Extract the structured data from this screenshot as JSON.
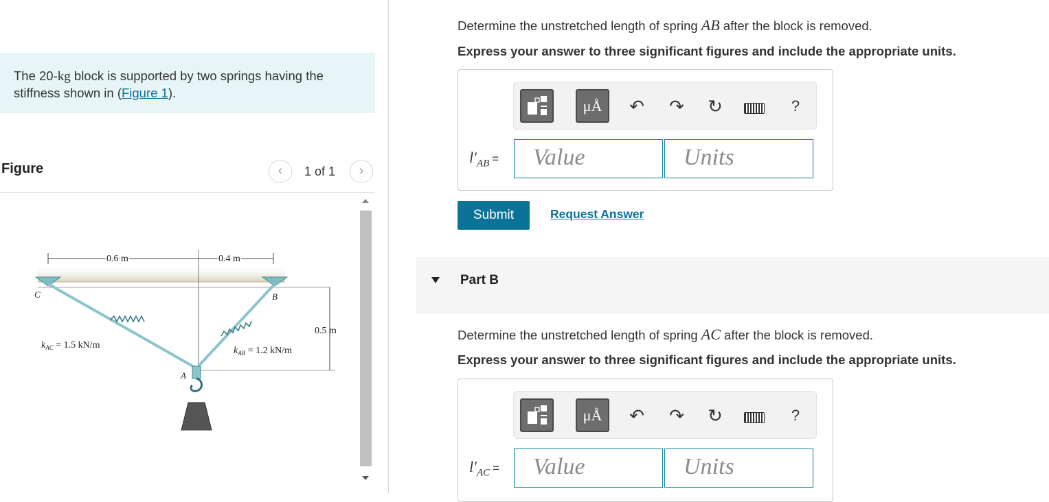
{
  "problem": {
    "intro_pre": "The 20-",
    "intro_kg": "kg",
    "intro_mid": " block is supported by two springs having the stiffness shown in (",
    "figure_link": "Figure 1",
    "intro_post": ")."
  },
  "figure": {
    "heading": "Figure",
    "pager": "1 of 1",
    "prev_icon": "chevron-left-icon",
    "next_icon": "chevron-right-icon",
    "labels": {
      "dim_left": "0.6 m",
      "dim_right": "0.4 m",
      "dim_vert": "0.5 m",
      "point_c": "C",
      "point_b": "B",
      "point_a": "A",
      "k_ac": "k",
      "k_ac_sub": "AC",
      "k_ac_val": " = 1.5 kN/m",
      "k_ab": "k",
      "k_ab_sub": "AB",
      "k_ab_val": " = 1.2 kN/m"
    }
  },
  "part_a": {
    "prompt_pre": "Determine the unstretched length of spring ",
    "prompt_var": "AB",
    "prompt_post": " after the block is removed.",
    "express": "Express your answer to three significant figures and include the appropriate units.",
    "var_main": "l′",
    "var_sub": "AB",
    "var_eq": "=",
    "value_placeholder": "Value",
    "units_placeholder": "Units",
    "toolbar": {
      "templates_icon": "fraction-template-icon",
      "units_symbol": "μÅ",
      "undo_icon": "undo-icon",
      "redo_icon": "redo-icon",
      "reset_icon": "reset-icon",
      "keyboard_icon": "keyboard-icon",
      "help": "?"
    },
    "submit": "Submit",
    "request": "Request Answer"
  },
  "part_b": {
    "title": "Part B",
    "prompt_pre": "Determine the unstretched length of spring ",
    "prompt_var": "AC",
    "prompt_post": " after the block is removed.",
    "express": "Express your answer to three significant figures and include the appropriate units.",
    "var_main": "l′",
    "var_sub": "AC",
    "var_eq": "=",
    "value_placeholder": "Value",
    "units_placeholder": "Units",
    "toolbar": {
      "units_symbol": "μÅ",
      "help": "?"
    }
  },
  "colors": {
    "accent": "#0b7398",
    "intro_bg": "#e8f5f6",
    "field_border": "#0b7fa0"
  }
}
